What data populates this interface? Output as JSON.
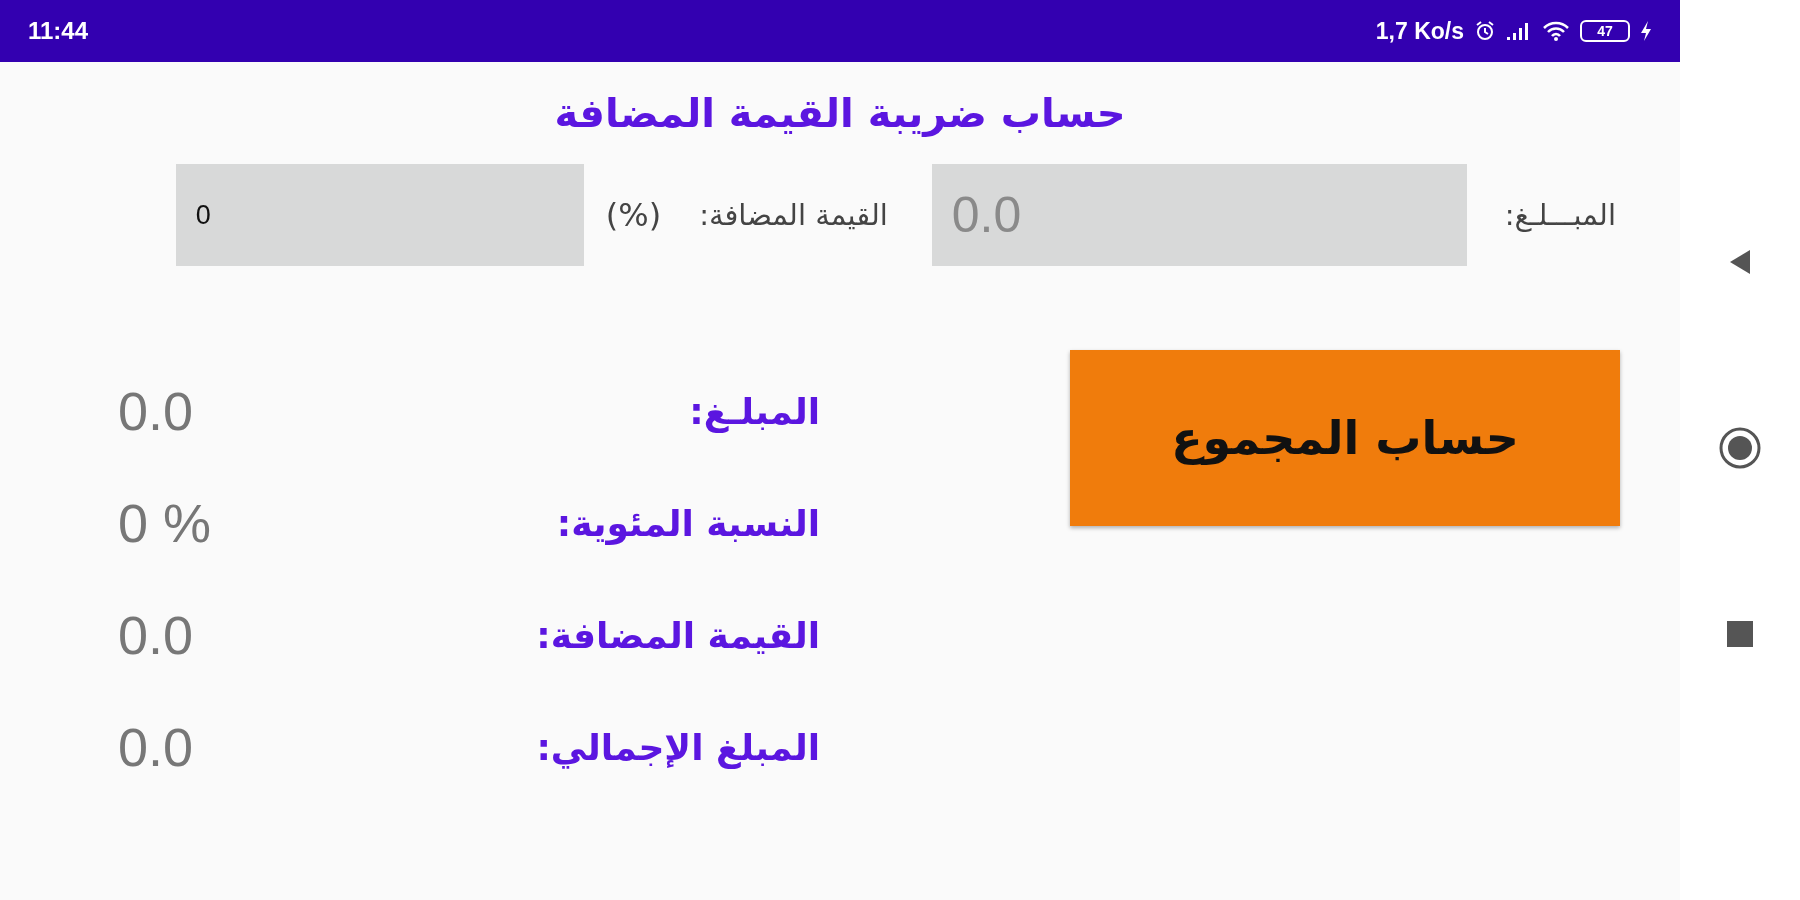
{
  "status_bar": {
    "time": "11:44",
    "speed": "1,7 Ko/s",
    "battery": "47"
  },
  "title": "حساب ضريبة القيمة المضافة",
  "inputs": [
    {
      "label": "المبـــلـغ:",
      "placeholder": "0.0"
    },
    {
      "label": "القيمة المضافة:",
      "unit": "(%)",
      "value": "0"
    }
  ],
  "button": "حساب المجموع",
  "results": [
    {
      "label": "المبلـغ:",
      "value": "0.0"
    },
    {
      "label": "النسبة المئوية:",
      "value": "0 %"
    },
    {
      "label": "القيمة المضافة:",
      "value": "0.0"
    },
    {
      "label": "المبلغ الإجمالي:",
      "value": "0.0"
    }
  ]
}
